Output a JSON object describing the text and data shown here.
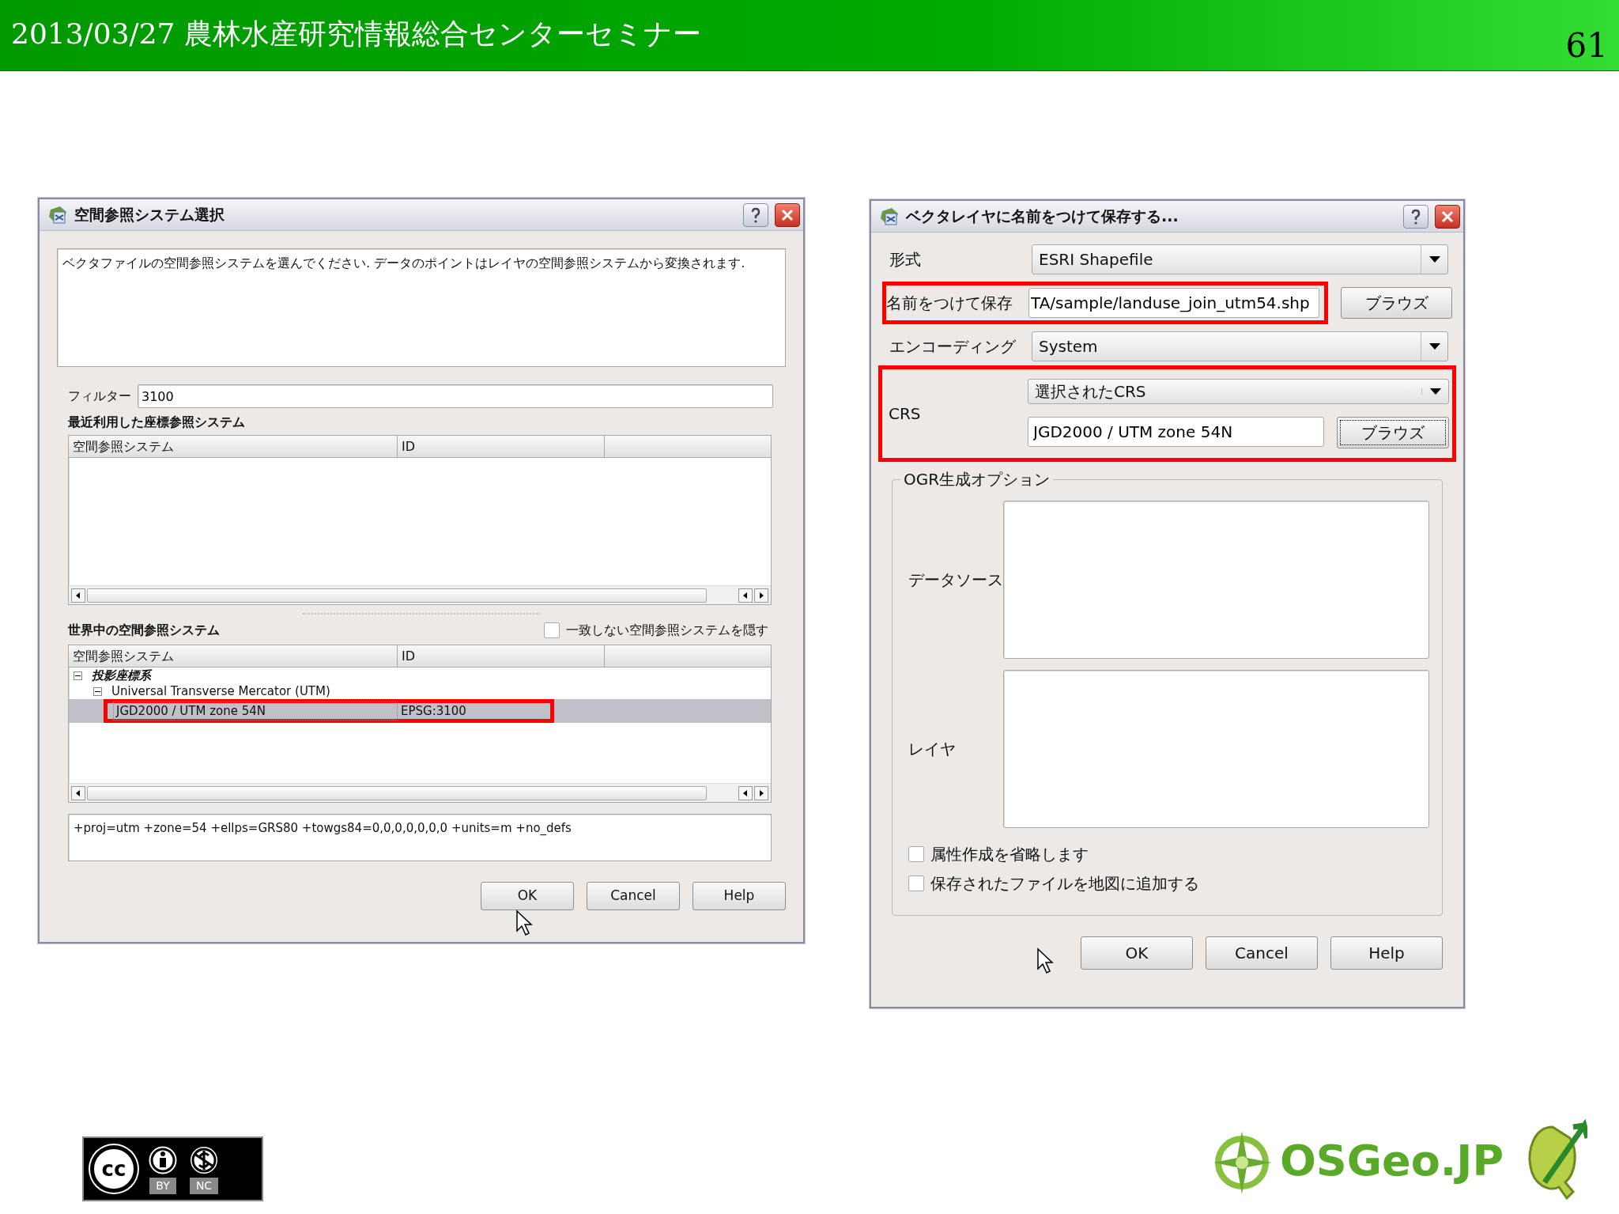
{
  "slide": {
    "title": "2013/03/27 農林水産研究情報総合センターセミナー",
    "page_number": "61"
  },
  "crs_dialog": {
    "title": "空間参照システム選択",
    "description": "ベクタファイルの空間参照システムを選んでください. データのポイントはレイヤの空間参照システムから変換されます.",
    "filter_label": "フィルター",
    "filter_value": "3100",
    "recent_heading": "最近利用した座標参照システム",
    "recent_columns": [
      "空間参照システム",
      "ID"
    ],
    "world_heading": "世界中の空間参照システム",
    "hide_checkbox": {
      "label": "一致しない空間参照システムを隠す",
      "checked": false
    },
    "world_columns": [
      "空間参照システム",
      "ID"
    ],
    "tree": [
      {
        "name": "投影座標系",
        "selected": false,
        "expanded": true,
        "children": [
          {
            "name": "Universal Transverse Mercator (UTM)",
            "selected": false,
            "expanded": true,
            "children": [
              {
                "name": "JGD2000 / UTM zone 54N",
                "id": "EPSG:3100",
                "selected": true,
                "highlighted": true
              }
            ]
          }
        ]
      }
    ],
    "proj_string": "+proj=utm +zone=54 +ellps=GRS80 +towgs84=0,0,0,0,0,0,0 +units=m +no_defs",
    "buttons": [
      "OK",
      "Cancel",
      "Help"
    ]
  },
  "save_dialog": {
    "title": "ベクタレイヤに名前をつけて保存する...",
    "format_label": "形式",
    "format": "ESRI  Shapefile",
    "save_as_label": "名前をつけて保存",
    "save_as_value": "TA/sample/landuse_join_utm54.shp",
    "save_as_highlighted": true,
    "browse": "ブラウズ",
    "encoding_label": "エンコーディング",
    "encoding": "System",
    "crs_label": "CRS",
    "crs_highlighted": true,
    "crs_mode": "選択されたCRS",
    "crs_value": "JGD2000 / UTM zone 54N",
    "crs_browse": "ブラウズ",
    "crs_browse_focused": true,
    "ogr_legend": "OGR生成オプション",
    "datasource_label": "データソース",
    "layer_label": "レイヤ",
    "checkboxes": [
      {
        "label": "属性作成を省略します",
        "checked": false
      },
      {
        "label": "保存されたファイルを地図に追加する",
        "checked": false
      }
    ],
    "buttons": [
      "OK",
      "Cancel",
      "Help"
    ]
  },
  "footer": {
    "cc": "cc",
    "license_labels": [
      "BY",
      "NC"
    ],
    "osgeo": "OSGeo.JP"
  }
}
